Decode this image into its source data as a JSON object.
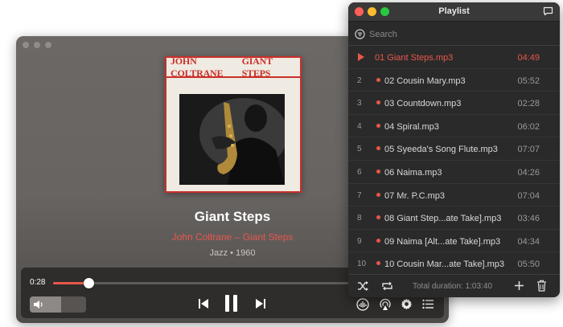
{
  "player": {
    "album_cover": {
      "artist_text": "JOHN COLTRANE",
      "album_text": "GIANT STEPS"
    },
    "track": {
      "title": "Giant Steps",
      "artist_album": "John Coltrane – Giant Steps",
      "meta": "Jazz • 1960"
    },
    "elapsed": "0:28",
    "progress": 0.12,
    "volume": 0.55,
    "accent_color": "#e8574a",
    "icons": [
      "volume-icon",
      "previous-icon",
      "pause-icon",
      "next-icon",
      "equalizer-icon",
      "airplay-icon",
      "gear-icon",
      "playlist-icon"
    ]
  },
  "playlist": {
    "title": "Playlist",
    "search_placeholder": "Search",
    "items": [
      {
        "number": "",
        "name": "01 Giant Steps.mp3",
        "duration": "04:49",
        "active": true
      },
      {
        "number": "2",
        "name": "02 Cousin Mary.mp3",
        "duration": "05:52"
      },
      {
        "number": "3",
        "name": "03 Countdown.mp3",
        "duration": "02:28"
      },
      {
        "number": "4",
        "name": "04 Spiral.mp3",
        "duration": "06:02"
      },
      {
        "number": "5",
        "name": "05 Syeeda's Song Flute.mp3",
        "duration": "07:07"
      },
      {
        "number": "6",
        "name": "06 Naima.mp3",
        "duration": "04:26"
      },
      {
        "number": "7",
        "name": "07 Mr. P.C.mp3",
        "duration": "07:04"
      },
      {
        "number": "8",
        "name": "08 Giant Step...ate Take].mp3",
        "duration": "03:46"
      },
      {
        "number": "9",
        "name": "09 Naima [Alt...ate Take].mp3",
        "duration": "04:34"
      },
      {
        "number": "10",
        "name": "10 Cousin Mar...ate Take].mp3",
        "duration": "05:50"
      }
    ],
    "total_duration": "Total duration: 1:03:40",
    "icons": [
      "chat-icon",
      "search-icon",
      "shuffle-icon",
      "repeat-icon",
      "add-icon",
      "trash-icon"
    ]
  }
}
